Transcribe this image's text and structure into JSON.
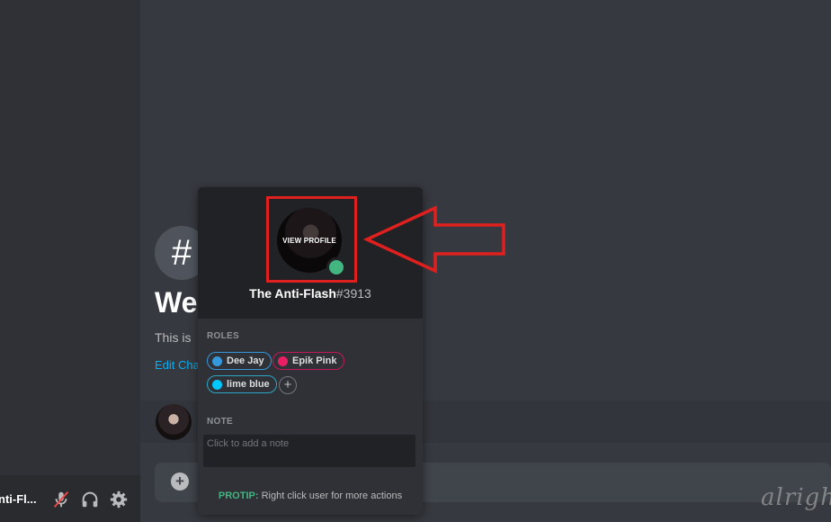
{
  "user_panel": {
    "username": "nti-Fl..."
  },
  "welcome": {
    "hash_symbol": "#",
    "title": "We",
    "subtitle": "This is",
    "edit_link": "Edit Cha"
  },
  "popout": {
    "view_profile": "VIEW PROFILE",
    "username": "The Anti-Flash",
    "discriminator": "#3913",
    "roles_label": "ROLES",
    "roles": [
      {
        "name": "Dee Jay",
        "color": "#3498db",
        "border": "#3498db"
      },
      {
        "name": "Epik Pink",
        "color": "#e91e63",
        "border": "#c2185b"
      },
      {
        "name": "lime blue",
        "color": "#00c8ff",
        "border": "#2ca5c5"
      }
    ],
    "add_role": "+",
    "note_label": "NOTE",
    "note_placeholder": "Click to add a note",
    "protip_label": "PROTIP:",
    "protip_text": " Right click user for more actions"
  },
  "composer": {
    "plus": "+"
  },
  "watermark": "alrigh",
  "colors": {
    "online": "#43b581",
    "annotation_red": "#e0201f",
    "link": "#00b0f4"
  }
}
